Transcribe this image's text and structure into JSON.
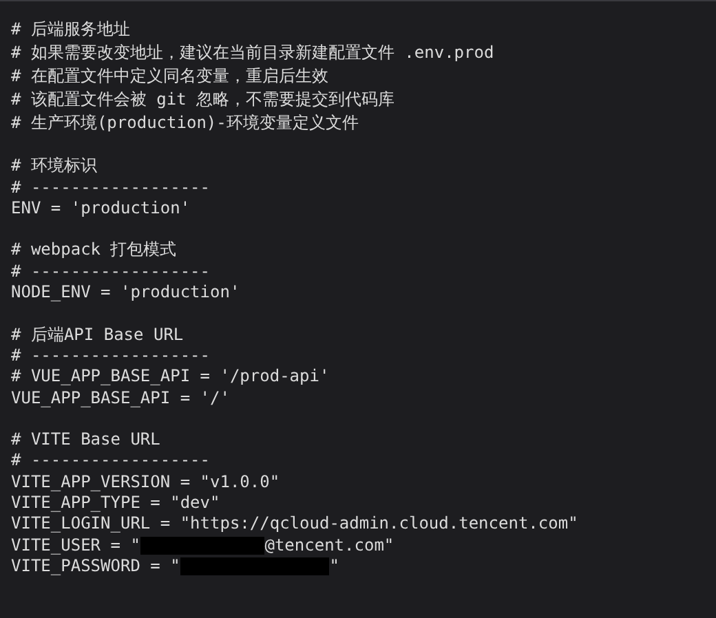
{
  "blocks": [
    {
      "lines": [
        {
          "kind": "code",
          "text": "# 后端服务地址"
        },
        {
          "kind": "code",
          "text": "# 如果需要改变地址，建议在当前目录新建配置文件 .env.prod"
        },
        {
          "kind": "code",
          "text": "# 在配置文件中定义同名变量，重启后生效"
        },
        {
          "kind": "code",
          "text": "# 该配置文件会被 git 忽略，不需要提交到代码库"
        },
        {
          "kind": "code",
          "text": "# 生产环境(production)-环境变量定义文件"
        }
      ]
    },
    {
      "lines": [
        {
          "kind": "code",
          "text": "# 环境标识"
        },
        {
          "kind": "code",
          "text": "# ------------------"
        },
        {
          "kind": "code",
          "text": "ENV = 'production'"
        }
      ]
    },
    {
      "lines": [
        {
          "kind": "code",
          "text": "# webpack 打包模式"
        },
        {
          "kind": "code",
          "text": "# ------------------"
        },
        {
          "kind": "code",
          "text": "NODE_ENV = 'production'"
        }
      ]
    },
    {
      "lines": [
        {
          "kind": "code",
          "text": "# 后端API Base URL"
        },
        {
          "kind": "code",
          "text": "# ------------------"
        },
        {
          "kind": "code",
          "text": "# VUE_APP_BASE_API = '/prod-api'"
        },
        {
          "kind": "code",
          "text": "VUE_APP_BASE_API = '/'"
        }
      ]
    },
    {
      "lines": [
        {
          "kind": "code",
          "text": "# VITE Base URL"
        },
        {
          "kind": "code",
          "text": "# ------------------"
        },
        {
          "kind": "code",
          "text": "VITE_APP_VERSION = \"v1.0.0\""
        },
        {
          "kind": "code",
          "text": "VITE_APP_TYPE = \"dev\""
        },
        {
          "kind": "code",
          "text": "VITE_LOGIN_URL = \"https://qcloud-admin.cloud.tencent.com\""
        },
        {
          "kind": "redacted",
          "before": "VITE_USER = \"",
          "after": "@tencent.com\""
        },
        {
          "kind": "redacted",
          "before": "VITE_PASSWORD = \"",
          "after": "\""
        }
      ]
    }
  ]
}
